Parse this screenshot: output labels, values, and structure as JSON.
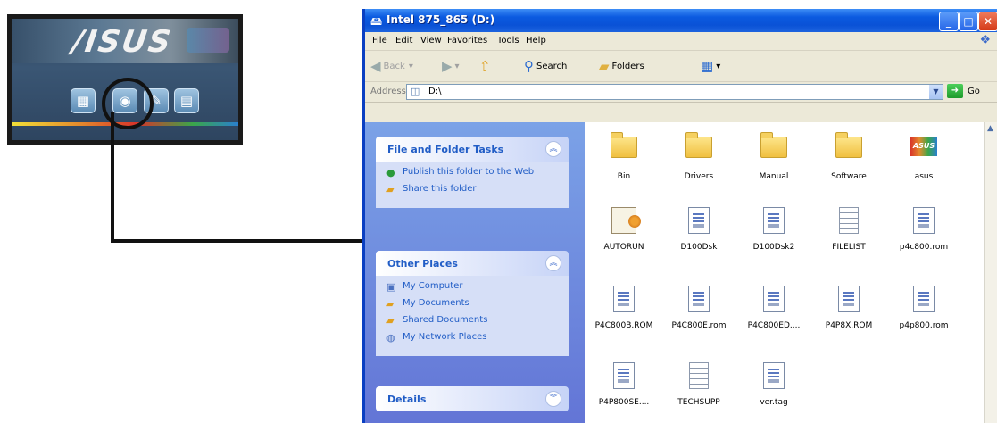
{
  "inset": {
    "logo": "/ISUS",
    "buttons": [
      "drivers-icon",
      "disc-icon",
      "wrench-icon",
      "document-icon"
    ]
  },
  "window": {
    "title": "Intel 875_865 (D:)",
    "menu": [
      "File",
      "Edit",
      "View",
      "Favorites",
      "Tools",
      "Help"
    ],
    "toolbar": {
      "back": "Back",
      "search": "Search",
      "folders": "Folders"
    },
    "address": {
      "label": "Address",
      "value": "D:\\",
      "go": "Go"
    }
  },
  "taskpane": {
    "panels": [
      {
        "title": "File and Folder Tasks",
        "tasks": [
          "Publish this folder to the Web",
          "Share this folder"
        ]
      },
      {
        "title": "Other Places",
        "tasks": [
          "My Computer",
          "My Documents",
          "Shared Documents",
          "My Network Places"
        ]
      },
      {
        "title": "Details",
        "tasks": []
      }
    ]
  },
  "files": [
    {
      "name": "Bin",
      "type": "folder"
    },
    {
      "name": "Drivers",
      "type": "folder"
    },
    {
      "name": "Manual",
      "type": "folder"
    },
    {
      "name": "Software",
      "type": "folder"
    },
    {
      "name": "asus",
      "type": "image"
    },
    {
      "name": "AUTORUN",
      "type": "setup"
    },
    {
      "name": "D100Dsk",
      "type": "doc"
    },
    {
      "name": "D100Dsk2",
      "type": "doc"
    },
    {
      "name": "FILELIST",
      "type": "text"
    },
    {
      "name": "p4c800.rom",
      "type": "doc"
    },
    {
      "name": "P4C800B.ROM",
      "type": "doc"
    },
    {
      "name": "P4C800E.rom",
      "type": "doc"
    },
    {
      "name": "P4C800ED....",
      "type": "doc"
    },
    {
      "name": "P4P8X.ROM",
      "type": "doc"
    },
    {
      "name": "p4p800.rom",
      "type": "doc"
    },
    {
      "name": "P4P800SE....",
      "type": "doc"
    },
    {
      "name": "TECHSUPP",
      "type": "text"
    },
    {
      "name": "ver.tag",
      "type": "doc"
    }
  ]
}
